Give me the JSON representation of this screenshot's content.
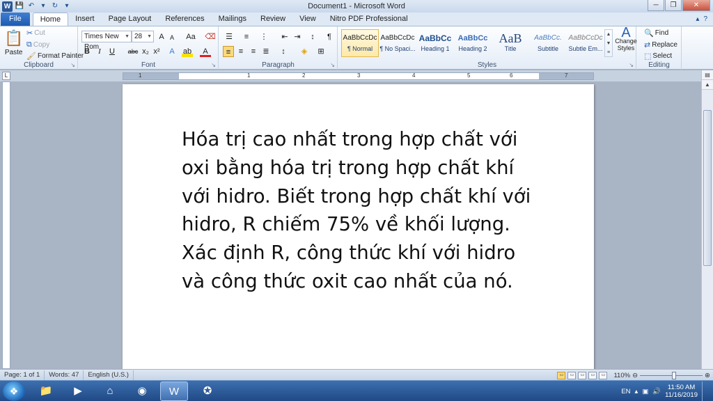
{
  "window": {
    "title": "Document1 - Microsoft Word",
    "controls": {
      "minimize": "─",
      "restore": "❐",
      "close": "✕"
    }
  },
  "tabs": [
    "File",
    "Home",
    "Insert",
    "Page Layout",
    "References",
    "Mailings",
    "Review",
    "View",
    "Nitro PDF Professional"
  ],
  "active_tab": "Home",
  "clipboard": {
    "paste": "Paste",
    "cut": "Cut",
    "copy": "Copy",
    "format_painter": "Format Painter",
    "label": "Clipboard"
  },
  "font": {
    "name": "Times New Rom",
    "size": "28",
    "label": "Font",
    "buttons": {
      "bold": "B",
      "italic": "I",
      "underline": "U",
      "strike": "abc",
      "subscript": "x₂",
      "superscript": "x²",
      "grow": "A",
      "shrink": "A",
      "case": "Aa"
    }
  },
  "paragraph": {
    "label": "Paragraph",
    "pilcrow": "¶"
  },
  "styles": {
    "label": "Styles",
    "items": [
      {
        "preview": "AaBbCcDc",
        "name": "¶ Normal"
      },
      {
        "preview": "AaBbCcDc",
        "name": "¶ No Spaci..."
      },
      {
        "preview": "AaBbCc",
        "name": "Heading 1"
      },
      {
        "preview": "AaBbCc",
        "name": "Heading 2"
      },
      {
        "preview": "AaB",
        "name": "Title"
      },
      {
        "preview": "AaBbCc.",
        "name": "Subtitle"
      },
      {
        "preview": "AaBbCcDc",
        "name": "Subtle Em..."
      }
    ],
    "change_styles": "Change Styles"
  },
  "editing": {
    "label": "Editing",
    "find": "Find",
    "replace": "Replace",
    "select": "Select"
  },
  "ruler": {
    "numbers": [
      "1",
      "1",
      "2",
      "3",
      "4",
      "5",
      "6",
      "7"
    ]
  },
  "document": {
    "text": "Hóa trị cao nhất trong hợp chất với oxi bằng hóa trị trong hợp chất khí với hidro. Biết trong hợp chất khí với hidro, R chiếm 75% về khối lượng. Xác định R, công thức khí với hidro và công thức oxit cao nhất của nó."
  },
  "status": {
    "page": "Page: 1 of 1",
    "words": "Words: 47",
    "language": "English (U.S.)",
    "zoom": "110%",
    "zoom_fraction": 0.55
  },
  "taskbar": {
    "language": "EN",
    "time": "11:50 AM",
    "date": "11/16/2019"
  }
}
